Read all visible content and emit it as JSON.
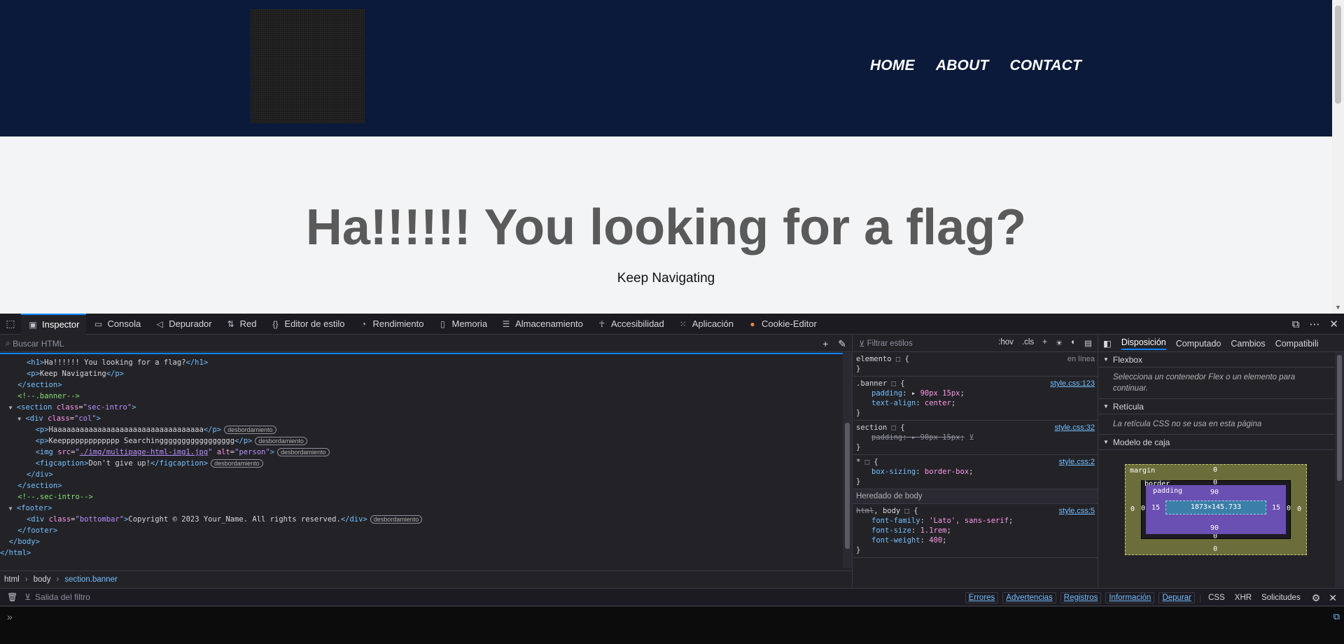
{
  "site": {
    "nav": [
      "HOME",
      "ABOUT",
      "CONTACT"
    ],
    "banner_title": "Ha!!!!!! You looking for a flag?",
    "banner_subtitle": "Keep Navigating"
  },
  "devtools": {
    "tabs": [
      {
        "label": "Inspector",
        "icon": "inspector-icon"
      },
      {
        "label": "Consola",
        "icon": "console-icon"
      },
      {
        "label": "Depurador",
        "icon": "debugger-icon"
      },
      {
        "label": "Red",
        "icon": "network-icon"
      },
      {
        "label": "Editor de estilo",
        "icon": "style-editor-icon"
      },
      {
        "label": "Rendimiento",
        "icon": "performance-icon"
      },
      {
        "label": "Memoria",
        "icon": "memory-icon"
      },
      {
        "label": "Almacenamiento",
        "icon": "storage-icon"
      },
      {
        "label": "Accesibilidad",
        "icon": "accessibility-icon"
      },
      {
        "label": "Aplicación",
        "icon": "application-icon"
      },
      {
        "label": "Cookie-Editor",
        "icon": "cookie-icon"
      }
    ],
    "search_placeholder": "Buscar HTML",
    "tree": {
      "l1_text": "Ha!!!!!! You looking for a flag?",
      "l2_text": "Keep Navigating",
      "comment_banner": "<!--.banner-->",
      "sec_intro_class": "sec-intro",
      "col_class": "col",
      "p1_text": "Haaaaaaaaaaaaaaaaaaaaaaaaaaaaaaaaaa",
      "p2_text": "Keeppppppppppppp Searchinggggggggggggggggg",
      "img_src": "./img/multipage-html-img1.jpg",
      "img_alt": "person",
      "figcaption": "Don't give up!",
      "comment_intro": "<!--.sec-intro-->",
      "bottombar_class": "bottombar",
      "bottombar_text": "Copyright © 2023 Your_Name. All rights reserved.",
      "overflow_badge": "desbordamiento"
    },
    "breadcrumbs": [
      "html",
      "body",
      "section.banner"
    ],
    "rules": {
      "filter_placeholder": "Filtrar estilos",
      "hov": ":hov",
      "cls": ".cls",
      "element_label": "elemento",
      "inline_label": "en línea",
      "banner_selector": ".banner",
      "banner_src": "style.css:123",
      "banner_padding": "90px 15px",
      "banner_align": "center",
      "section_selector": "section",
      "section_src": "style.css:32",
      "section_padding": "90px 15px",
      "star_src": "style.css:2",
      "box_sizing": "border-box",
      "inherited_head": "Heredado de body",
      "body_src": "style.css:5",
      "font_family": "'Lato', sans-serif",
      "font_size": "1.1rem",
      "font_weight": "400"
    },
    "layout": {
      "tabs": [
        "Disposición",
        "Computado",
        "Cambios",
        "Compatibili"
      ],
      "flexbox_head": "Flexbox",
      "flexbox_msg": "Selecciona un contenedor Flex o un elemento para continuar.",
      "grid_head": "Retícula",
      "grid_msg": "La retícula CSS no se usa en esta página",
      "boxmodel_head": "Modelo de caja",
      "margin_label": "margin",
      "border_label": "border",
      "padding_label": "padding",
      "content_size": "1873×145.733",
      "margin_vals": {
        "top": "0",
        "right": "0",
        "bottom": "0",
        "left": "0"
      },
      "border_vals": {
        "top": "0",
        "right": "0",
        "bottom": "0",
        "left": "0"
      },
      "padding_vals": {
        "top": "90",
        "right": "15",
        "bottom": "90",
        "left": "15"
      }
    },
    "console": {
      "filter_placeholder": "Salida del filtro",
      "levels": [
        "Errores",
        "Advertencias",
        "Registros",
        "Información",
        "Depurar"
      ],
      "extras": [
        "CSS",
        "XHR",
        "Solicitudes"
      ],
      "prompt": "»"
    }
  }
}
